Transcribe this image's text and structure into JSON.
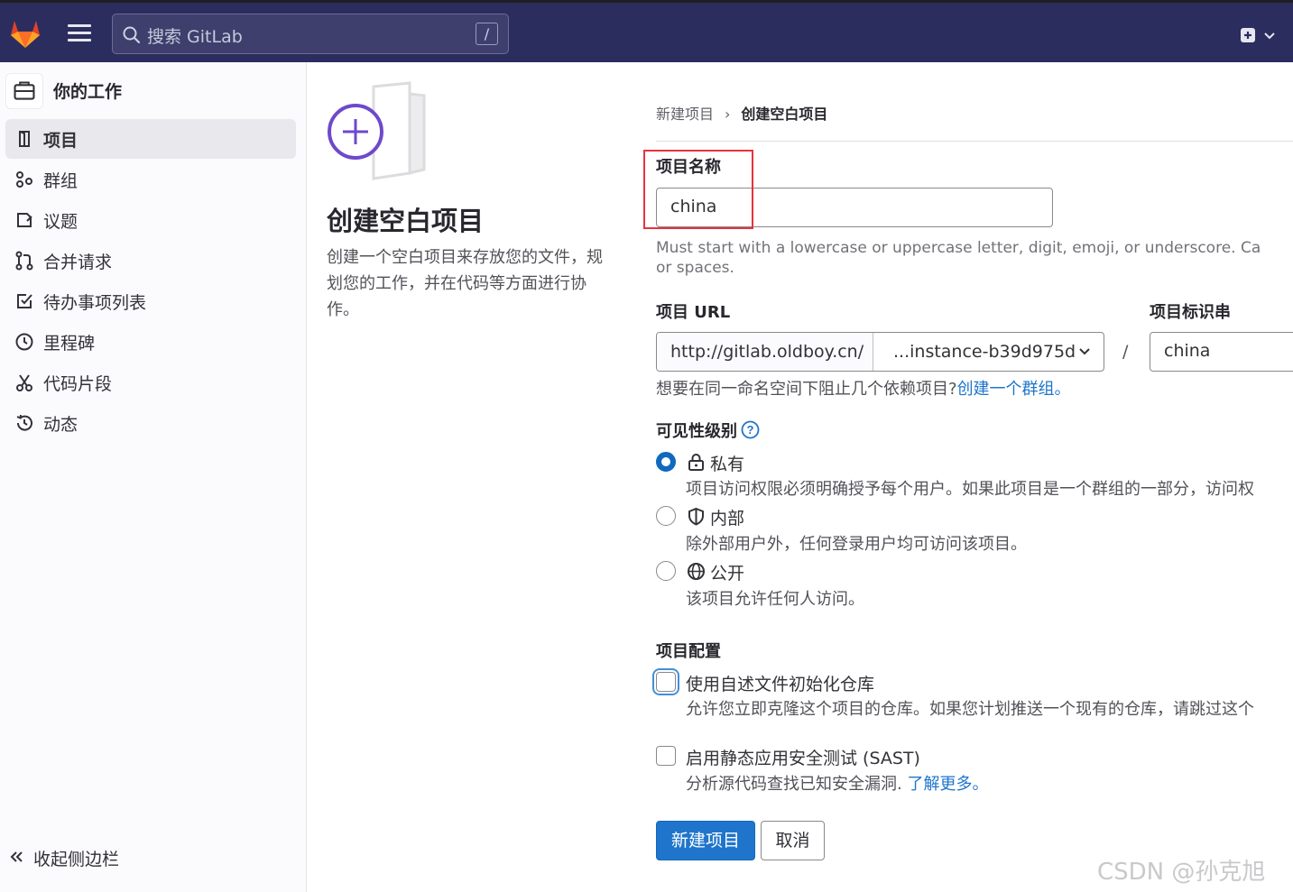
{
  "topbar": {
    "search_placeholder": "搜索 GitLab",
    "search_shortcut": "/"
  },
  "sidebar": {
    "context_title": "你的工作",
    "items": [
      {
        "label": "项目",
        "icon": "project-icon",
        "active": true
      },
      {
        "label": "群组",
        "icon": "group-icon",
        "active": false
      },
      {
        "label": "议题",
        "icon": "issues-icon",
        "active": false
      },
      {
        "label": "合并请求",
        "icon": "merge-request-icon",
        "active": false
      },
      {
        "label": "待办事项列表",
        "icon": "todo-icon",
        "active": false
      },
      {
        "label": "里程碑",
        "icon": "milestone-icon",
        "active": false
      },
      {
        "label": "代码片段",
        "icon": "snippet-icon",
        "active": false
      },
      {
        "label": "动态",
        "icon": "activity-icon",
        "active": false
      }
    ],
    "collapse_label": "收起侧边栏"
  },
  "info": {
    "title": "创建空白项目",
    "description": "创建一个空白项目来存放您的文件，规划您的工作，并在代码等方面进行协作。"
  },
  "breadcrumb": {
    "parent": "新建项目",
    "current": "创建空白项目"
  },
  "form": {
    "name_label": "项目名称",
    "name_value": "china",
    "name_help": "Must start with a lowercase or uppercase letter, digit, emoji, or underscore. Ca",
    "name_help_2": "or spaces.",
    "url_label": "项目 URL",
    "url_prefix": "http://gitlab.oldboy.cn/",
    "url_namespace": "...instance-b39d975d",
    "url_slash": "/",
    "slug_label": "项目标识串",
    "slug_value": "china",
    "namespace_help": "想要在同一命名空间下阻止几个依赖项目?",
    "namespace_help_link": "创建一个群组。",
    "visibility_label": "可见性级别",
    "visibility": [
      {
        "label": "私有",
        "icon": "lock-icon",
        "desc": "项目访问权限必须明确授予每个用户。如果此项目是一个群组的一部分，访问权",
        "checked": true
      },
      {
        "label": "内部",
        "icon": "shield-icon",
        "desc": "除外部用户外，任何登录用户均可访问该项目。",
        "checked": false
      },
      {
        "label": "公开",
        "icon": "earth-icon",
        "desc": "该项目允许任何人访问。",
        "checked": false
      }
    ],
    "config_label": "项目配置",
    "readme_label": "使用自述文件初始化仓库",
    "readme_desc": "允许您立即克隆这个项目的仓库。如果您计划推送一个现有的仓库，请跳过这个",
    "sast_label": "启用静态应用安全测试 (SAST)",
    "sast_desc": "分析源代码查找已知安全漏洞.",
    "sast_link": "了解更多。",
    "submit_label": "新建项目",
    "cancel_label": "取消"
  },
  "watermark": "CSDN @孙克旭",
  "colors": {
    "topbar_bg": "#2b2d5f",
    "primary": "#1f75cb",
    "highlight_box": "#e8323c"
  }
}
